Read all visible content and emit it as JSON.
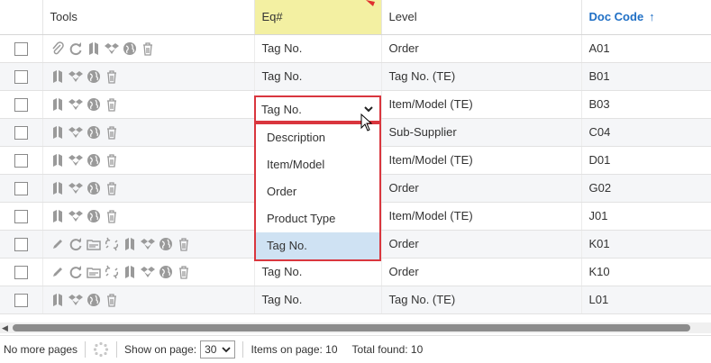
{
  "columns": {
    "tools": "Tools",
    "eq": "Eq#",
    "level": "Level",
    "doc_code": "Doc Code",
    "sort_indicator": "↑"
  },
  "rows": [
    {
      "tools": [
        "paperclip-icon",
        "refresh-icon",
        "book-icon",
        "dropbox-icon",
        "globe-icon",
        "trash-icon"
      ],
      "eq": "Tag No.",
      "level": "Order",
      "doc_code": "A01"
    },
    {
      "tools": [
        "book-icon",
        "dropbox-icon",
        "globe-icon",
        "trash-icon"
      ],
      "eq": "Tag No.",
      "level": "Tag No. (TE)",
      "doc_code": "B01"
    },
    {
      "tools": [
        "book-icon",
        "dropbox-icon",
        "globe-icon",
        "trash-icon"
      ],
      "eq": "Tag No.",
      "level": "Item/Model (TE)",
      "doc_code": "B03"
    },
    {
      "tools": [
        "book-icon",
        "dropbox-icon",
        "globe-icon",
        "trash-icon"
      ],
      "eq": "",
      "level": "Sub-Supplier",
      "doc_code": "C04"
    },
    {
      "tools": [
        "book-icon",
        "dropbox-icon",
        "globe-icon",
        "trash-icon"
      ],
      "eq": "",
      "level": "Item/Model (TE)",
      "doc_code": "D01"
    },
    {
      "tools": [
        "book-icon",
        "dropbox-icon",
        "globe-icon",
        "trash-icon"
      ],
      "eq": "",
      "level": "Order",
      "doc_code": "G02"
    },
    {
      "tools": [
        "book-icon",
        "dropbox-icon",
        "globe-icon",
        "trash-icon"
      ],
      "eq": "",
      "level": "Item/Model (TE)",
      "doc_code": "J01"
    },
    {
      "tools": [
        "pencil-icon",
        "refresh-icon",
        "folder-icon",
        "unlink-icon",
        "book-icon",
        "dropbox-icon",
        "globe-icon",
        "trash-icon"
      ],
      "eq": "",
      "level": "Order",
      "doc_code": "K01"
    },
    {
      "tools": [
        "pencil-icon",
        "refresh-icon",
        "folder-icon",
        "unlink-icon",
        "book-icon",
        "dropbox-icon",
        "globe-icon",
        "trash-icon"
      ],
      "eq": "Tag No.",
      "level": "Order",
      "doc_code": "K10"
    },
    {
      "tools": [
        "book-icon",
        "dropbox-icon",
        "globe-icon",
        "trash-icon"
      ],
      "eq": "Tag No.",
      "level": "Tag No. (TE)",
      "doc_code": "L01"
    }
  ],
  "editor": {
    "current_value": "Tag No.",
    "options": [
      "Description",
      "Item/Model",
      "Order",
      "Product Type",
      "Tag No."
    ],
    "selected_index": 4
  },
  "footer": {
    "pages_text": "No more pages",
    "show_on_page_label": "Show on page:",
    "page_size": "30",
    "items_on_page": "Items on page: 10",
    "total_found": "Total found: 10"
  },
  "colors": {
    "eq_header_bg": "#f3f0a2",
    "sorted_header": "#1f6fc5",
    "editor_border": "#d9363e",
    "selected_option_bg": "#cfe2f3",
    "icon_gray": "#9a9a9a"
  }
}
